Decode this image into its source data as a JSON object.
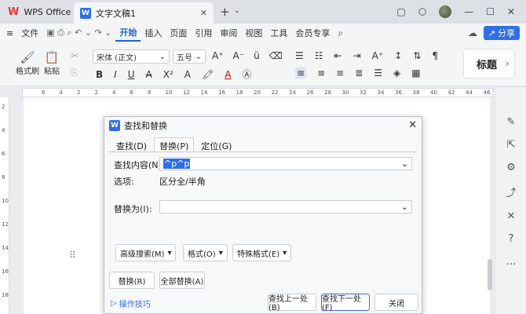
{
  "app": {
    "name": "WPS Office",
    "doc_tab": "文字文稿1"
  },
  "menu": {
    "file": "文件",
    "tabs": [
      "开始",
      "插入",
      "页面",
      "引用",
      "审阅",
      "视图",
      "工具",
      "会员专享"
    ],
    "share": "分享"
  },
  "ribbon": {
    "format_painter": "格式刷",
    "paste": "粘贴",
    "font_name": "宋体 (正文)",
    "font_size": "五号",
    "style_heading": "标题"
  },
  "ruler": {
    "ticks": [
      "6",
      "4",
      "2",
      "2",
      "4",
      "6",
      "8",
      "10",
      "12",
      "14",
      "16",
      "18",
      "20",
      "22",
      "24",
      "26",
      "28",
      "30",
      "32",
      "34",
      "36",
      "38",
      "40",
      "42",
      "44",
      "46"
    ]
  },
  "vruler": {
    "ticks": [
      "2",
      "4",
      "6",
      "8",
      "10",
      "12",
      "14",
      "16",
      "18"
    ]
  },
  "dialog": {
    "title": "查找和替换",
    "tabs": [
      "查找(D)",
      "替换(P)",
      "定位(G)"
    ],
    "find_label": "查找内容(N):",
    "find_value": "^p^p",
    "options_label": "选项:",
    "options_value": "区分全/半角",
    "replace_label": "替换为(I):",
    "replace_value": "",
    "advanced": "高级搜索(M)",
    "format": "格式(O)",
    "special": "特殊格式(E)",
    "replace_btn": "替换(R)",
    "replace_all_btn": "全部替换(A)",
    "tips": "操作技巧",
    "find_prev": "查找上一处(B)",
    "find_next": "查找下一处(F)",
    "close": "关闭"
  },
  "colors": {
    "accent": "#2f6fe6",
    "wps_red": "#e03a3a"
  }
}
